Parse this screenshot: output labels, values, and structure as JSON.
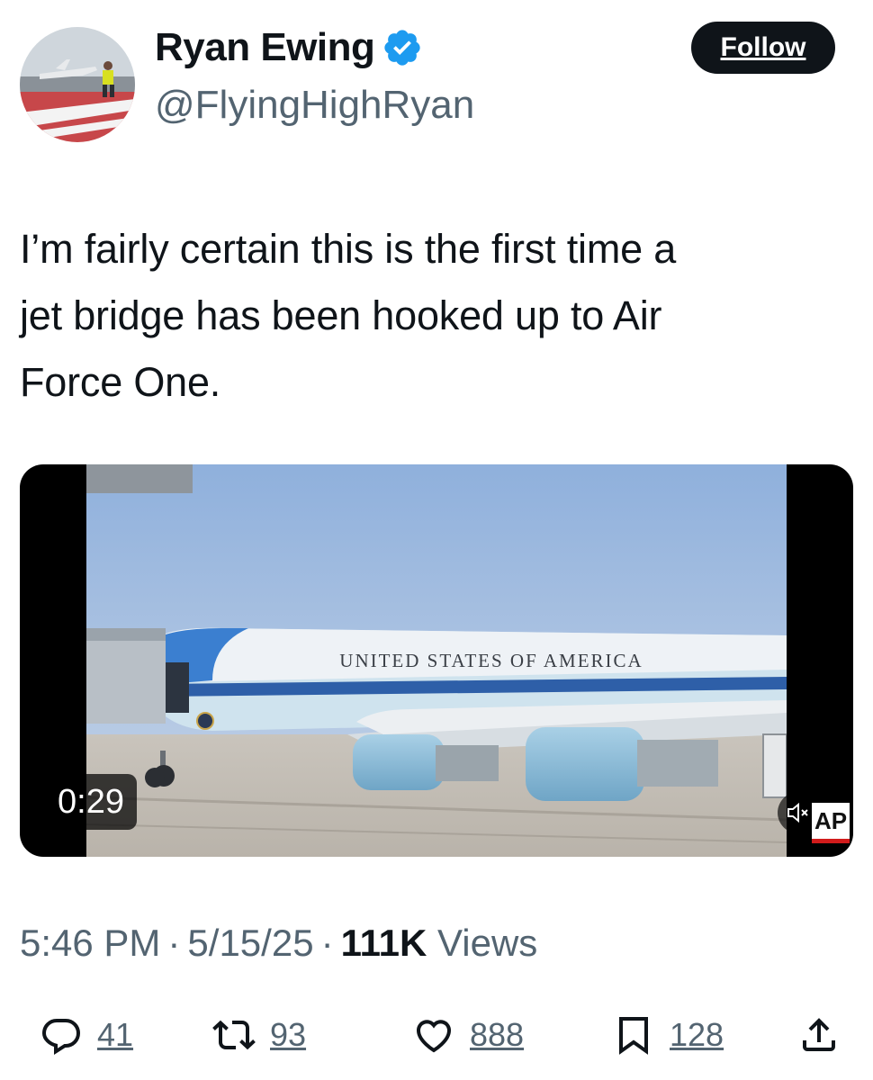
{
  "author": {
    "display_name": "Ryan Ewing",
    "handle": "@FlyingHighRyan",
    "verified": true,
    "avatar_icon": "user-avatar-photo"
  },
  "follow_button": {
    "label": "Follow"
  },
  "tweet": {
    "lines": [
      "I’m fairly certain this is the first time a",
      "jet bridge has been hooked up to Air",
      "Force One."
    ]
  },
  "media": {
    "aircraft_lettering": "UNITED STATES OF AMERICA",
    "duration": "0:29",
    "watermark": "AP",
    "mute_icon": "speaker-muted-icon"
  },
  "meta": {
    "time": "5:46 PM",
    "separator": "·",
    "date": "5/15/25",
    "views_count": "111K",
    "views_label": "Views"
  },
  "actions": {
    "replies": "41",
    "reposts": "93",
    "likes": "888",
    "bookmarks": "128"
  },
  "colors": {
    "text": "#0f1419",
    "secondary": "#536471",
    "verified": "#1d9bf0",
    "button": "#0f1419"
  }
}
